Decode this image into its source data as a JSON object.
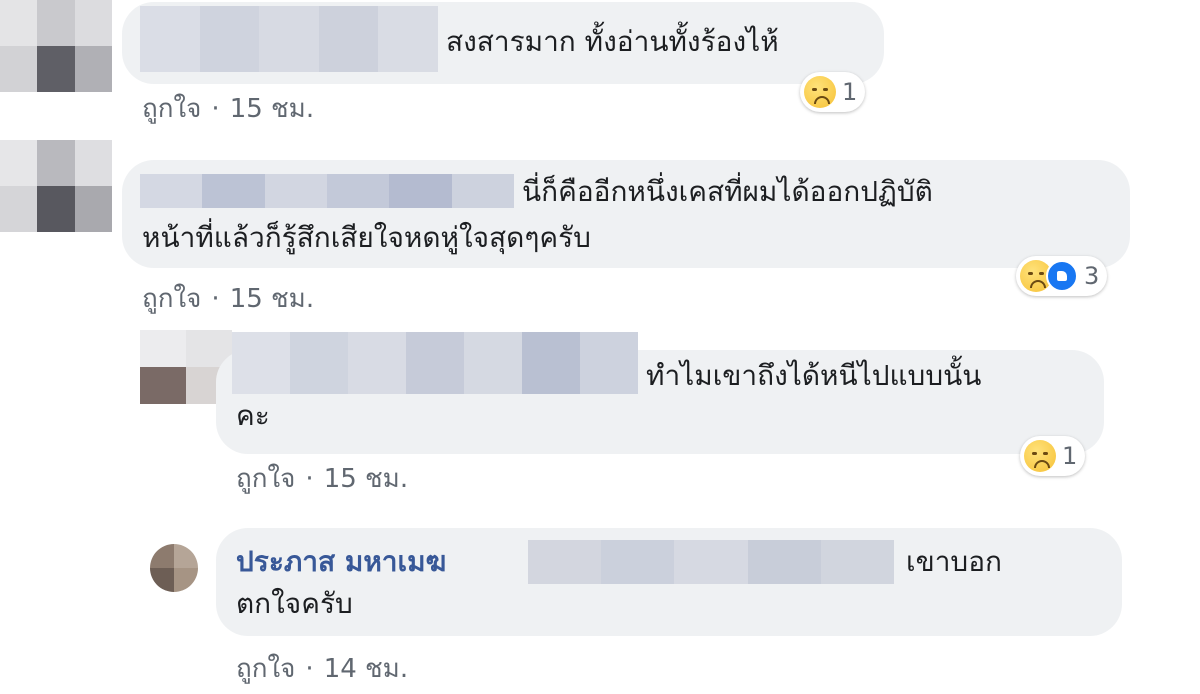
{
  "comments": [
    {
      "text": "สงสารมาก ทั้งอ่านทั้งร้องไห้",
      "like_label": "ถูกใจ",
      "separator": "·",
      "time": "15 ชม.",
      "reaction_count": "1"
    },
    {
      "text_line1": "นี่ก็คืออีกหนึ่งเคสที่ผมได้ออกปฏิบัติ",
      "text_line2": "หน้าที่แล้วก็รู้สึกเสียใจหดหู่ใจสุดๆครับ",
      "like_label": "ถูกใจ",
      "separator": "·",
      "time": "15 ชม.",
      "reaction_count": "3"
    },
    {
      "text_line1": "ทำไมเขาถึงได้หนีไปแบบนั้น",
      "text_line2": "คะ",
      "like_label": "ถูกใจ",
      "separator": "·",
      "time": "15 ชม.",
      "reaction_count": "1"
    },
    {
      "author": "ประภาส มหาเมฆ",
      "text_line1": "เขาบอก",
      "text_line2": "ตกใจครับ",
      "like_label": "ถูกใจ",
      "separator": "·",
      "time": "14 ชม."
    }
  ],
  "icons": {
    "sad_reaction": "sad-face-emoji",
    "like_reaction": "thumbs-up"
  },
  "colors": {
    "bubble": "#eff1f3",
    "author_link": "#385898",
    "meta_text": "#606770",
    "like_blue": "#1877f2"
  }
}
